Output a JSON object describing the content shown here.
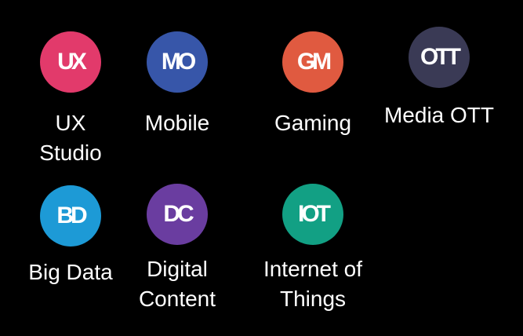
{
  "apps": [
    {
      "monogram": "UX",
      "label_lines": [
        "UX",
        "Studio"
      ],
      "color": "#e23a6b"
    },
    {
      "monogram": "MO",
      "label_lines": [
        "Mobile"
      ],
      "color": "#3756a9"
    },
    {
      "monogram": "GM",
      "label_lines": [
        "Gaming"
      ],
      "color": "#e05a40"
    },
    {
      "monogram": "OTT",
      "label_lines": [
        "Media OTT"
      ],
      "color": "#3a3a55"
    },
    {
      "monogram": "BD",
      "label_lines": [
        "Big Data"
      ],
      "color": "#1d9ad6"
    },
    {
      "monogram": "DC",
      "label_lines": [
        "Digital",
        "Content"
      ],
      "color": "#6a3da0"
    },
    {
      "monogram": "IOT",
      "label_lines": [
        "Internet of",
        "Things"
      ],
      "color": "#12a084"
    }
  ]
}
